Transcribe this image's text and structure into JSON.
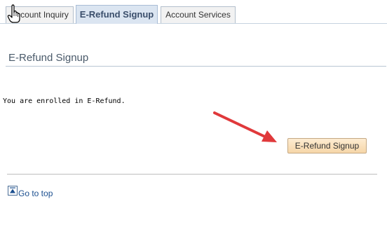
{
  "tabs": [
    {
      "label": "Account Inquiry",
      "active": false
    },
    {
      "label": "E-Refund Signup",
      "active": true
    },
    {
      "label": "Account Services",
      "active": false
    }
  ],
  "page": {
    "title": "E-Refund Signup",
    "status_message": "You are enrolled in E-Refund.",
    "action_button_label": "E-Refund Signup",
    "go_to_top_label": "Go to top"
  },
  "colors": {
    "active_tab_bg": "#dbe5f1",
    "button_bg": "#f6d6a8",
    "link": "#1b4f8f",
    "annotation_arrow": "#e0393b"
  },
  "icons": {
    "cursor": "hand-pointer-icon",
    "go_to_top": "arrow-up-icon",
    "annotation": "red-arrow-annotation"
  }
}
